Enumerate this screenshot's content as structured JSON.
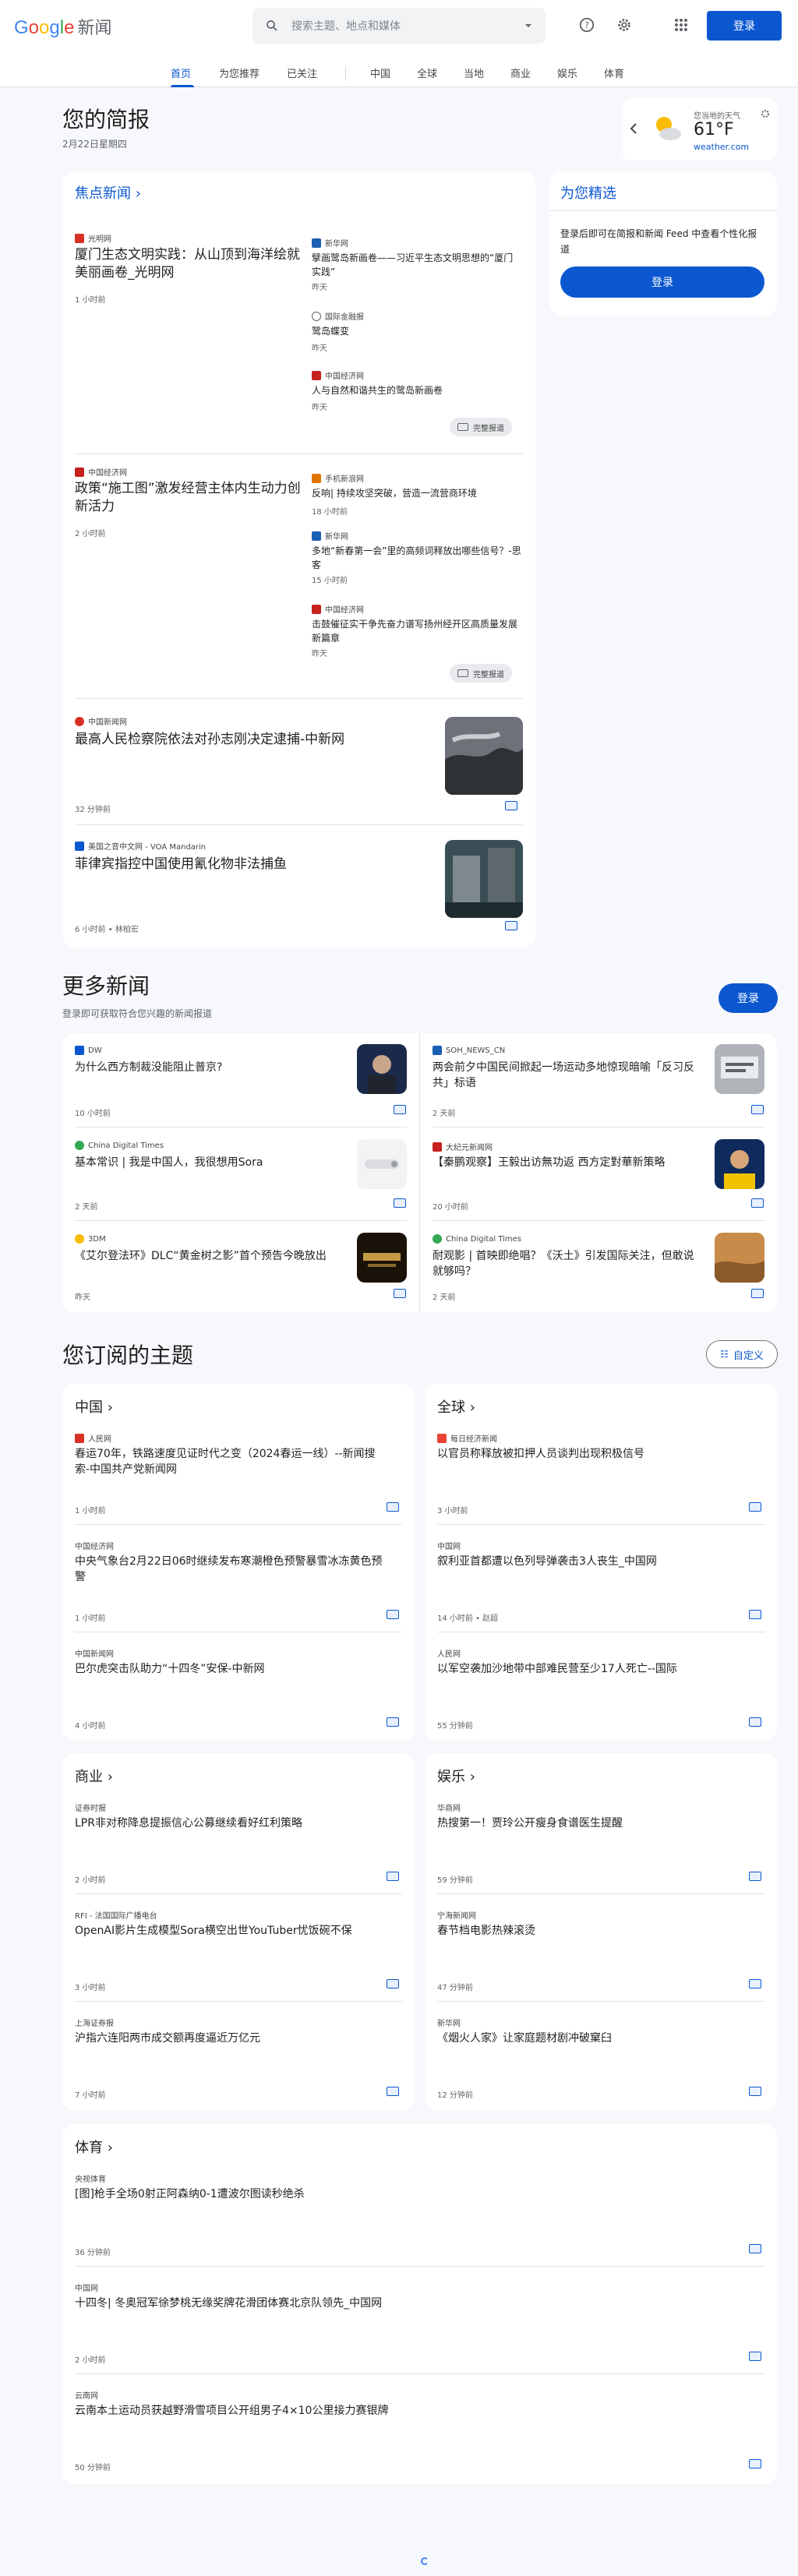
{
  "header": {
    "logo_google": "Google",
    "logo_news": "新闻",
    "search_placeholder": "搜索主题、地点和媒体",
    "signin": "登录",
    "icons": [
      "help-icon",
      "settings-icon",
      "apps-icon"
    ]
  },
  "nav": {
    "tabs": [
      "首页",
      "为您推荐",
      "已关注",
      "中国",
      "全球",
      "当地",
      "商业",
      "娱乐",
      "体育"
    ],
    "active": "首页"
  },
  "briefing": {
    "title": "您的简报",
    "date": "2月22日星期四"
  },
  "weather": {
    "label": "您当地的天气",
    "temp": "61°F",
    "source": "weather.com"
  },
  "top": {
    "title": "焦点新闻",
    "story1": {
      "source": "光明网",
      "headline": "厦门生态文明实践：从山顶到海洋绘就美丽画卷_光明网",
      "time": "1 小时前",
      "related": [
        {
          "source": "新华网",
          "headline": "擘画鹭岛新画卷——习近平生态文明思想的“厦门实践”",
          "time": "昨天"
        },
        {
          "source": "国际金融报",
          "headline": "鹭岛蝶变",
          "time": "昨天"
        },
        {
          "source": "中国经济网",
          "headline": "人与自然和谐共生的鹭岛新画卷",
          "time": "昨天"
        }
      ],
      "full": "完整报道"
    },
    "story2": {
      "source": "中国经济网",
      "headline": "政策“施工图”激发经营主体内生动力创新活力",
      "time": "2 小时前",
      "related": [
        {
          "source": "手机新浪网",
          "headline": "反响| 持续攻坚突破，营造一流营商环境",
          "time": "18 小时前"
        },
        {
          "source": "新华网",
          "headline": "多地“新春第一会”里的高频词释放出哪些信号？-思客",
          "time": "15 小时前"
        },
        {
          "source": "中国经济网",
          "headline": "击鼓催征实干争先奋力谱写扬州经开区高质量发展新篇章",
          "time": "昨天"
        }
      ],
      "full": "完整报道"
    },
    "story3": {
      "source": "中国新闻网",
      "headline": "最高人民检察院依法对孙志刚决定逮捕-中新网",
      "time": "32 分钟前"
    },
    "story4": {
      "source": "美国之音中文网 - VOA Mandarin",
      "headline": "菲律宾指控中国使用氰化物非法捕鱼",
      "time": "6 小时前 • 林柏宏"
    }
  },
  "foryou": {
    "title": "为您精选",
    "desc": "登录后即可在简报和新闻 Feed 中查看个性化报道",
    "signin": "登录"
  },
  "more": {
    "title": "更多新闻",
    "desc": "登录即可获取符合您兴趣的新闻报道",
    "signin": "登录",
    "items": [
      {
        "source": "DW",
        "headline": "为什么西方制裁没能阻止普京?",
        "time": "10 小时前"
      },
      {
        "source": "SOH_NEWS_CN",
        "headline": "两会前夕中国民间掀起一场运动多地惊现暗喻「反习反共」标语",
        "time": "2 天前"
      },
      {
        "source": "China Digital Times",
        "headline": "基本常识 | 我是中国人，我很想用Sora",
        "time": "2 天前"
      },
      {
        "source": "大纪元新闻网",
        "headline": "【秦鹏观察】王毅出访無功返 西方定對華新策略",
        "time": "20 小时前"
      },
      {
        "source": "3DM",
        "headline": "《艾尔登法环》DLC“黄金树之影”首个预告今晚放出",
        "time": "昨天"
      },
      {
        "source": "China Digital Times",
        "headline": "耐观影 | 首映即绝唱？《沃土》引发国际关注，但敢说就够吗？",
        "time": "2 天前"
      }
    ]
  },
  "topics": {
    "title": "您订阅的主题",
    "customize": "自定义",
    "sections": [
      {
        "name": "中国",
        "items": [
          {
            "source": "人民网",
            "headline": "春运70年，铁路速度见证时代之变（2024春运一线）--新闻搜索-中国共产党新闻网",
            "time": "1 小时前"
          },
          {
            "source": "中国经济网",
            "headline": "中央气象台2月22日06时继续发布寒潮橙色预警暴雪冰冻黄色预警",
            "time": "1 小时前"
          },
          {
            "source": "中国新闻网",
            "headline": "巴尔虎突击队助力“十四冬”安保-中新网",
            "time": "4 小时前"
          }
        ]
      },
      {
        "name": "全球",
        "items": [
          {
            "source": "每日经济新闻",
            "headline": "以官员称释放被扣押人员谈判出现积极信号",
            "time": "3 小时前"
          },
          {
            "source": "中国网",
            "headline": "叙利亚首都遭以色列导弹袭击3人丧生_中国网",
            "time": "14 小时前 • 赵超"
          },
          {
            "source": "人民网",
            "headline": "以军空袭加沙地带中部难民营至少17人死亡--国际",
            "time": "55 分钟前"
          }
        ]
      },
      {
        "name": "商业",
        "items": [
          {
            "source": "证券时报",
            "headline": "LPR非对称降息提振信心公募继续看好红利策略",
            "time": "2 小时前"
          },
          {
            "source": "RFI - 法国国际广播电台",
            "headline": "OpenAI影片生成模型Sora横空出世YouTuber忧饭碗不保",
            "time": "3 小时前"
          },
          {
            "source": "上海证券报",
            "headline": "沪指六连阳两市成交额再度逼近万亿元",
            "time": "7 小时前"
          }
        ]
      },
      {
        "name": "娱乐",
        "items": [
          {
            "source": "华商网",
            "headline": "热搜第一！贾玲公开瘦身食谱医生提醒",
            "time": "59 分钟前"
          },
          {
            "source": "宁海新闻网",
            "headline": "春节档电影热辣滚烫",
            "time": "47 分钟前"
          },
          {
            "source": "新华网",
            "headline": "《烟火人家》让家庭题材剧冲破窠臼",
            "time": "12 分钟前"
          }
        ]
      },
      {
        "name": "体育",
        "items": [
          {
            "source": "央视体育",
            "headline": "[图]枪手全场0射正阿森纳0-1遭波尔图读秒绝杀",
            "time": "36 分钟前"
          },
          {
            "source": "中国网",
            "headline": "十四冬| 冬奥冠军徐梦桃无缘奖牌花滑团体赛北京队领先_中国网",
            "time": "2 小时前"
          },
          {
            "source": "云南网",
            "headline": "云南本土运动员获越野滑雪项目公开组男子4×10公里接力赛银牌",
            "time": "50 分钟前"
          }
        ]
      }
    ]
  }
}
